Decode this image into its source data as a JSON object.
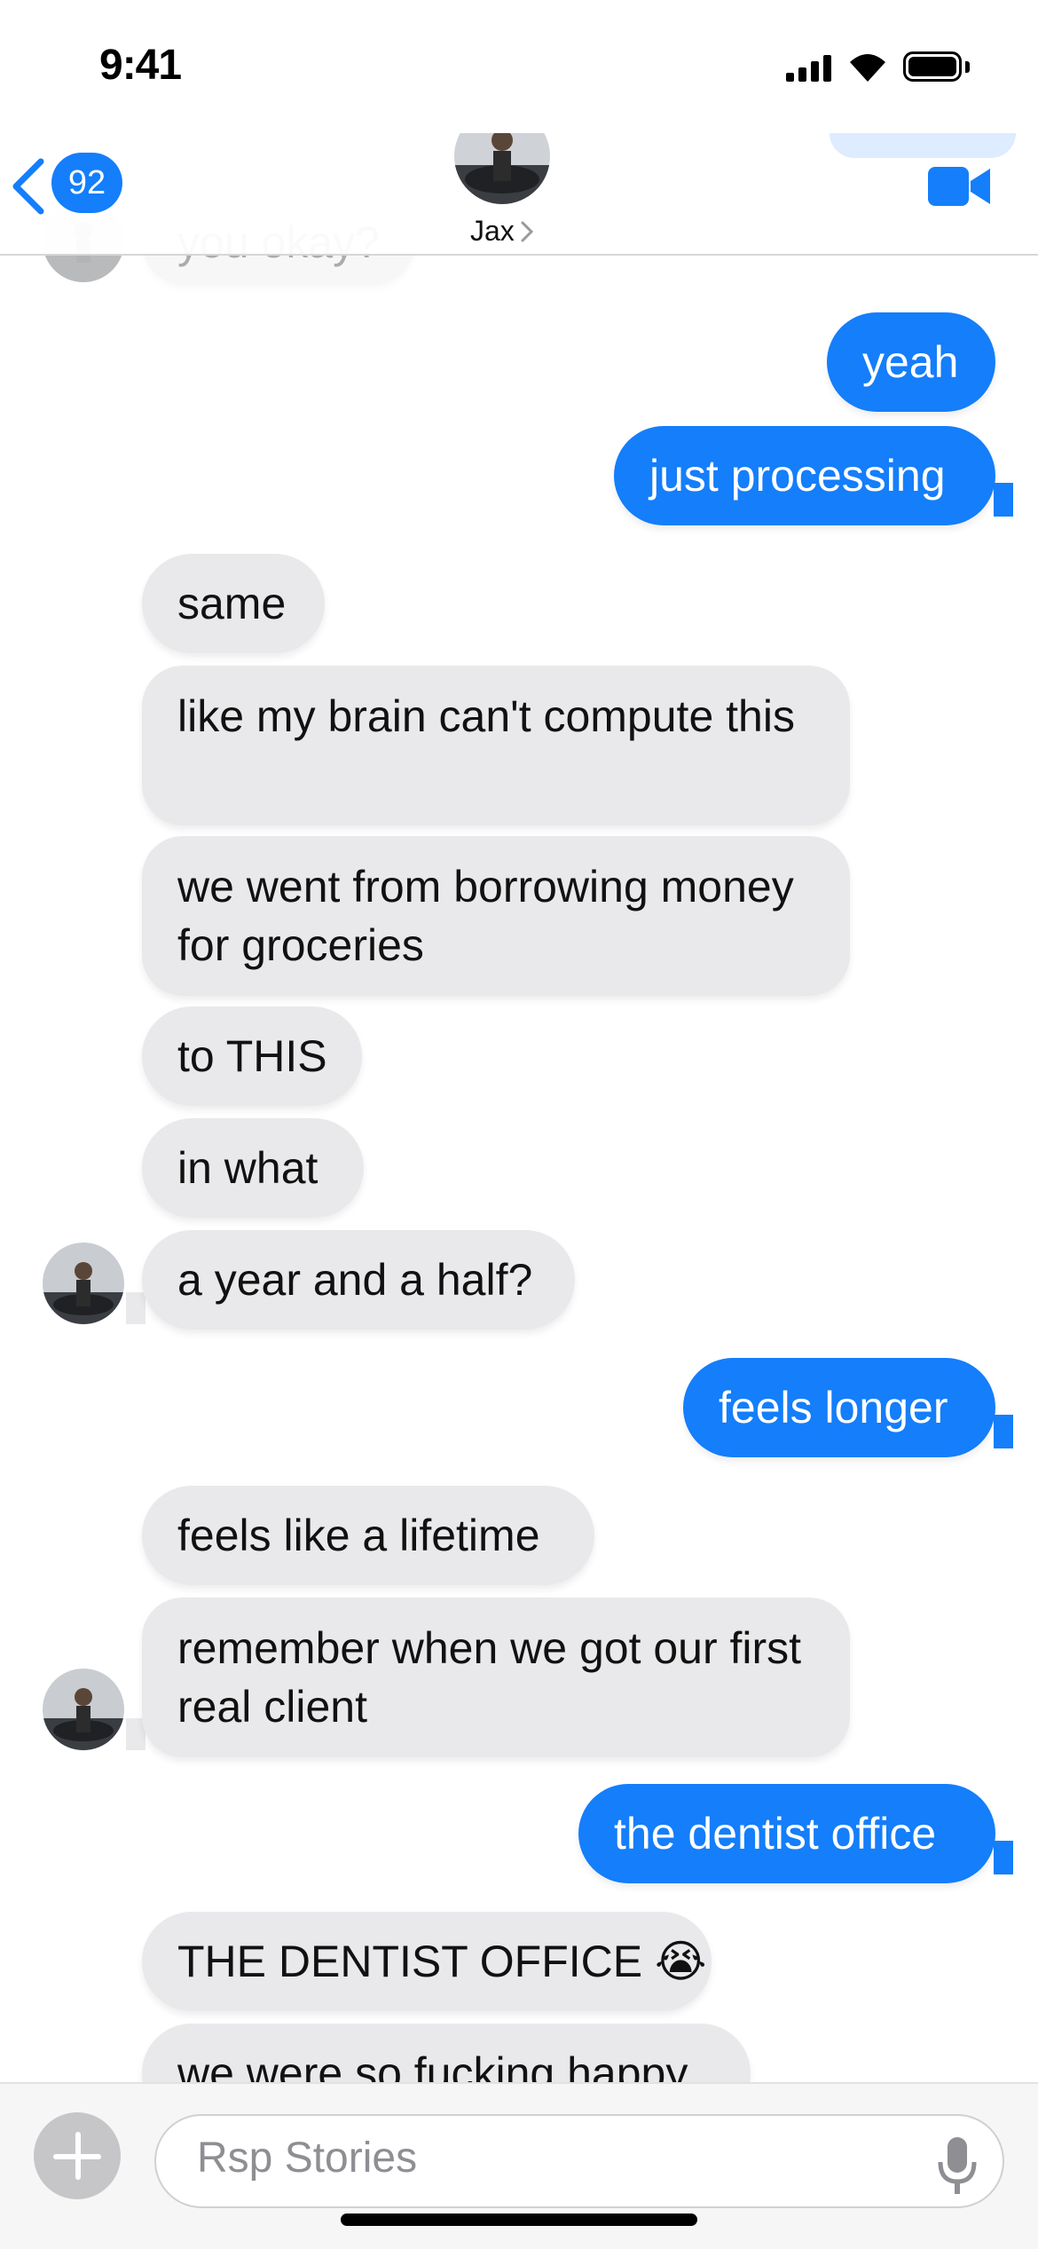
{
  "status_bar": {
    "time": "9:41"
  },
  "header": {
    "back_count": "92",
    "contact_name": "Jax"
  },
  "messages": [
    {
      "sender": "contact",
      "text": "you okay?"
    },
    {
      "sender": "me",
      "text": "yeah"
    },
    {
      "sender": "me",
      "text": "just processing"
    },
    {
      "sender": "contact",
      "text": "same"
    },
    {
      "sender": "contact",
      "text": "like my brain can't compute this"
    },
    {
      "sender": "contact",
      "text": "we went from borrowing money for groceries"
    },
    {
      "sender": "contact",
      "text": "to THIS"
    },
    {
      "sender": "contact",
      "text": "in what"
    },
    {
      "sender": "contact",
      "text": "a year and a half?"
    },
    {
      "sender": "me",
      "text": "feels longer"
    },
    {
      "sender": "contact",
      "text": "feels like a lifetime"
    },
    {
      "sender": "contact",
      "text": "remember when we got our first real client"
    },
    {
      "sender": "me",
      "text": "the dentist office"
    },
    {
      "sender": "contact",
      "text": "THE DENTIST OFFICE 😭"
    },
    {
      "sender": "contact",
      "text": "we were so fucking happy"
    }
  ],
  "composer": {
    "placeholder": "Rsp Stories"
  },
  "colors": {
    "outgoing": "#147efb",
    "incoming": "#e9e9eb",
    "accent": "#147efb"
  },
  "icons": [
    "signal-icon",
    "wifi-icon",
    "battery-icon",
    "back-chevron-icon",
    "video-call-icon",
    "plus-icon",
    "microphone-icon"
  ]
}
